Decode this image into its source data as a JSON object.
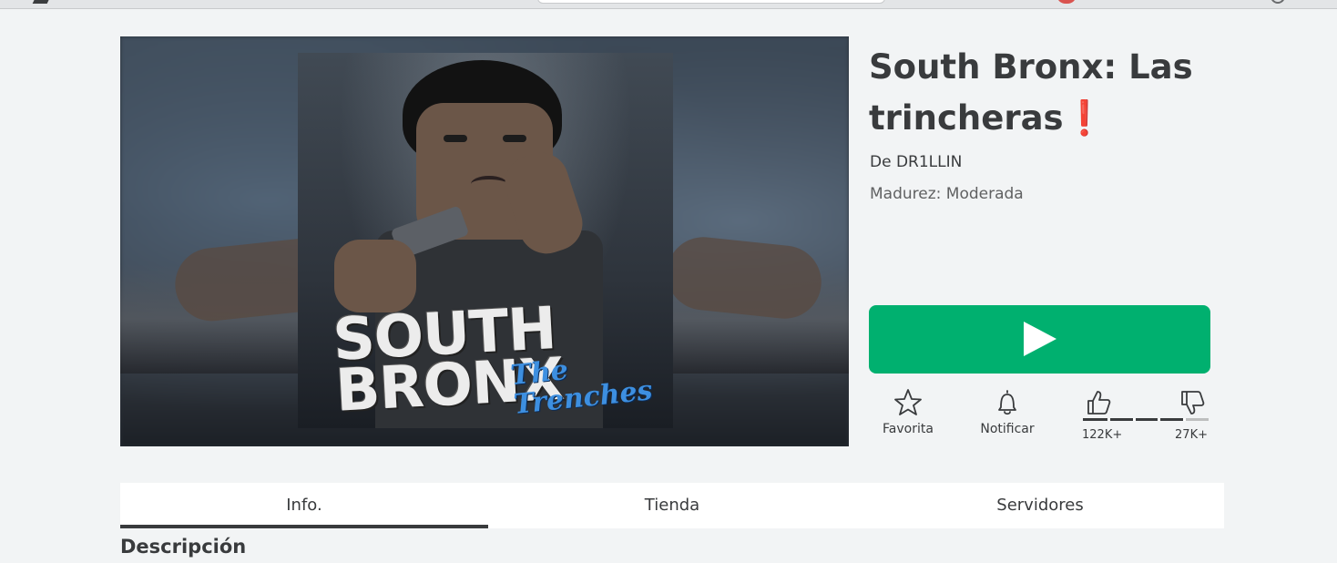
{
  "game": {
    "title": "South Bronx: Las trincheras",
    "title_emoji": "❗",
    "creator_prefix": "De",
    "creator_name": "DR1LLIN",
    "maturity": "Madurez: Moderada"
  },
  "thumbnail": {
    "title_main": "SOUTH BRONX",
    "title_sub": "The Trenches"
  },
  "actions": {
    "favorite_label": "Favorita",
    "notify_label": "Notificar",
    "upvotes": "122K+",
    "downvotes": "27K+",
    "like_ratio": 0.82
  },
  "tabs": [
    {
      "label": "Info.",
      "active": true
    },
    {
      "label": "Tienda",
      "active": false
    },
    {
      "label": "Servidores",
      "active": false
    }
  ],
  "sections": {
    "description_heading": "Descripción"
  },
  "colors": {
    "play_button": "#00b06f",
    "text_primary": "#393b3d",
    "page_bg": "#f2f4f5"
  },
  "icons": {
    "play": "play-icon",
    "favorite": "star-icon",
    "notify": "bell-icon",
    "upvote": "thumbs-up-icon",
    "downvote": "thumbs-down-icon"
  }
}
